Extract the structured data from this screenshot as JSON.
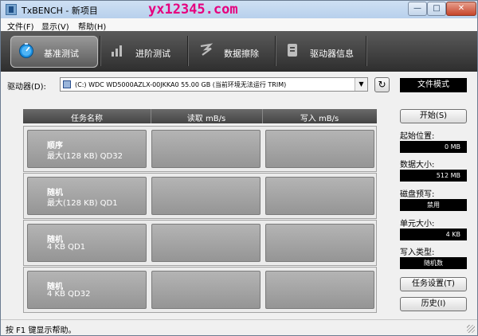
{
  "window": {
    "title": "TxBENCH - 新项目",
    "watermark": "yx12345.com",
    "minimize_glyph": "—",
    "maximize_glyph": "□",
    "close_glyph": "✕"
  },
  "menu": [
    {
      "label": "文件(F)"
    },
    {
      "label": "显示(V)"
    },
    {
      "label": "帮助(H)"
    }
  ],
  "tabs": [
    {
      "label": "基准测试",
      "icon": "speedometer-icon",
      "active": true
    },
    {
      "label": "进阶测试",
      "icon": "bar-chart-icon",
      "active": false
    },
    {
      "label": "数据擦除",
      "icon": "eraser-icon",
      "active": false
    },
    {
      "label": "驱动器信息",
      "icon": "drive-info-icon",
      "active": false
    }
  ],
  "drive": {
    "label": "驱动器(D):",
    "selected": "(C:) WDC WD5000AZLX-00JKKA0  55.00 GB (当前环境无法运行 TRIM)",
    "mode": "文件模式"
  },
  "grid": {
    "headers": [
      "任务名称",
      "读取 mB/s",
      "写入 mB/s"
    ],
    "rows": [
      {
        "line1": "顺序",
        "line2": "最大(128 KB) QD32",
        "read": "",
        "write": ""
      },
      {
        "line1": "随机",
        "line2": "最大(128 KB) QD1",
        "read": "",
        "write": ""
      },
      {
        "line1": "随机",
        "line2": "4 KB QD1",
        "read": "",
        "write": ""
      },
      {
        "line1": "随机",
        "line2": "4 KB QD32",
        "read": "",
        "write": ""
      }
    ]
  },
  "panel": {
    "start_label": "开始(S)",
    "start_pos_label": "起始位置:",
    "start_pos_value": "0 MB",
    "data_size_label": "数据大小:",
    "data_size_value": "512 MB",
    "prefill_label": "磁盘预写:",
    "prefill_value": "禁用",
    "unit_size_label": "单元大小:",
    "unit_size_value": "4 KB",
    "write_type_label": "写入类型:",
    "write_type_value": "随机数",
    "task_settings_label": "任务设置(T)",
    "history_label": "历史(I)"
  },
  "status": {
    "text": "按 F1 键显示帮助。"
  },
  "colors": {
    "toolbar_dark": "#2e2e2e",
    "cell_gray": "#a5a5a5",
    "watermark": "#e6007e",
    "value_bg": "#000000"
  }
}
